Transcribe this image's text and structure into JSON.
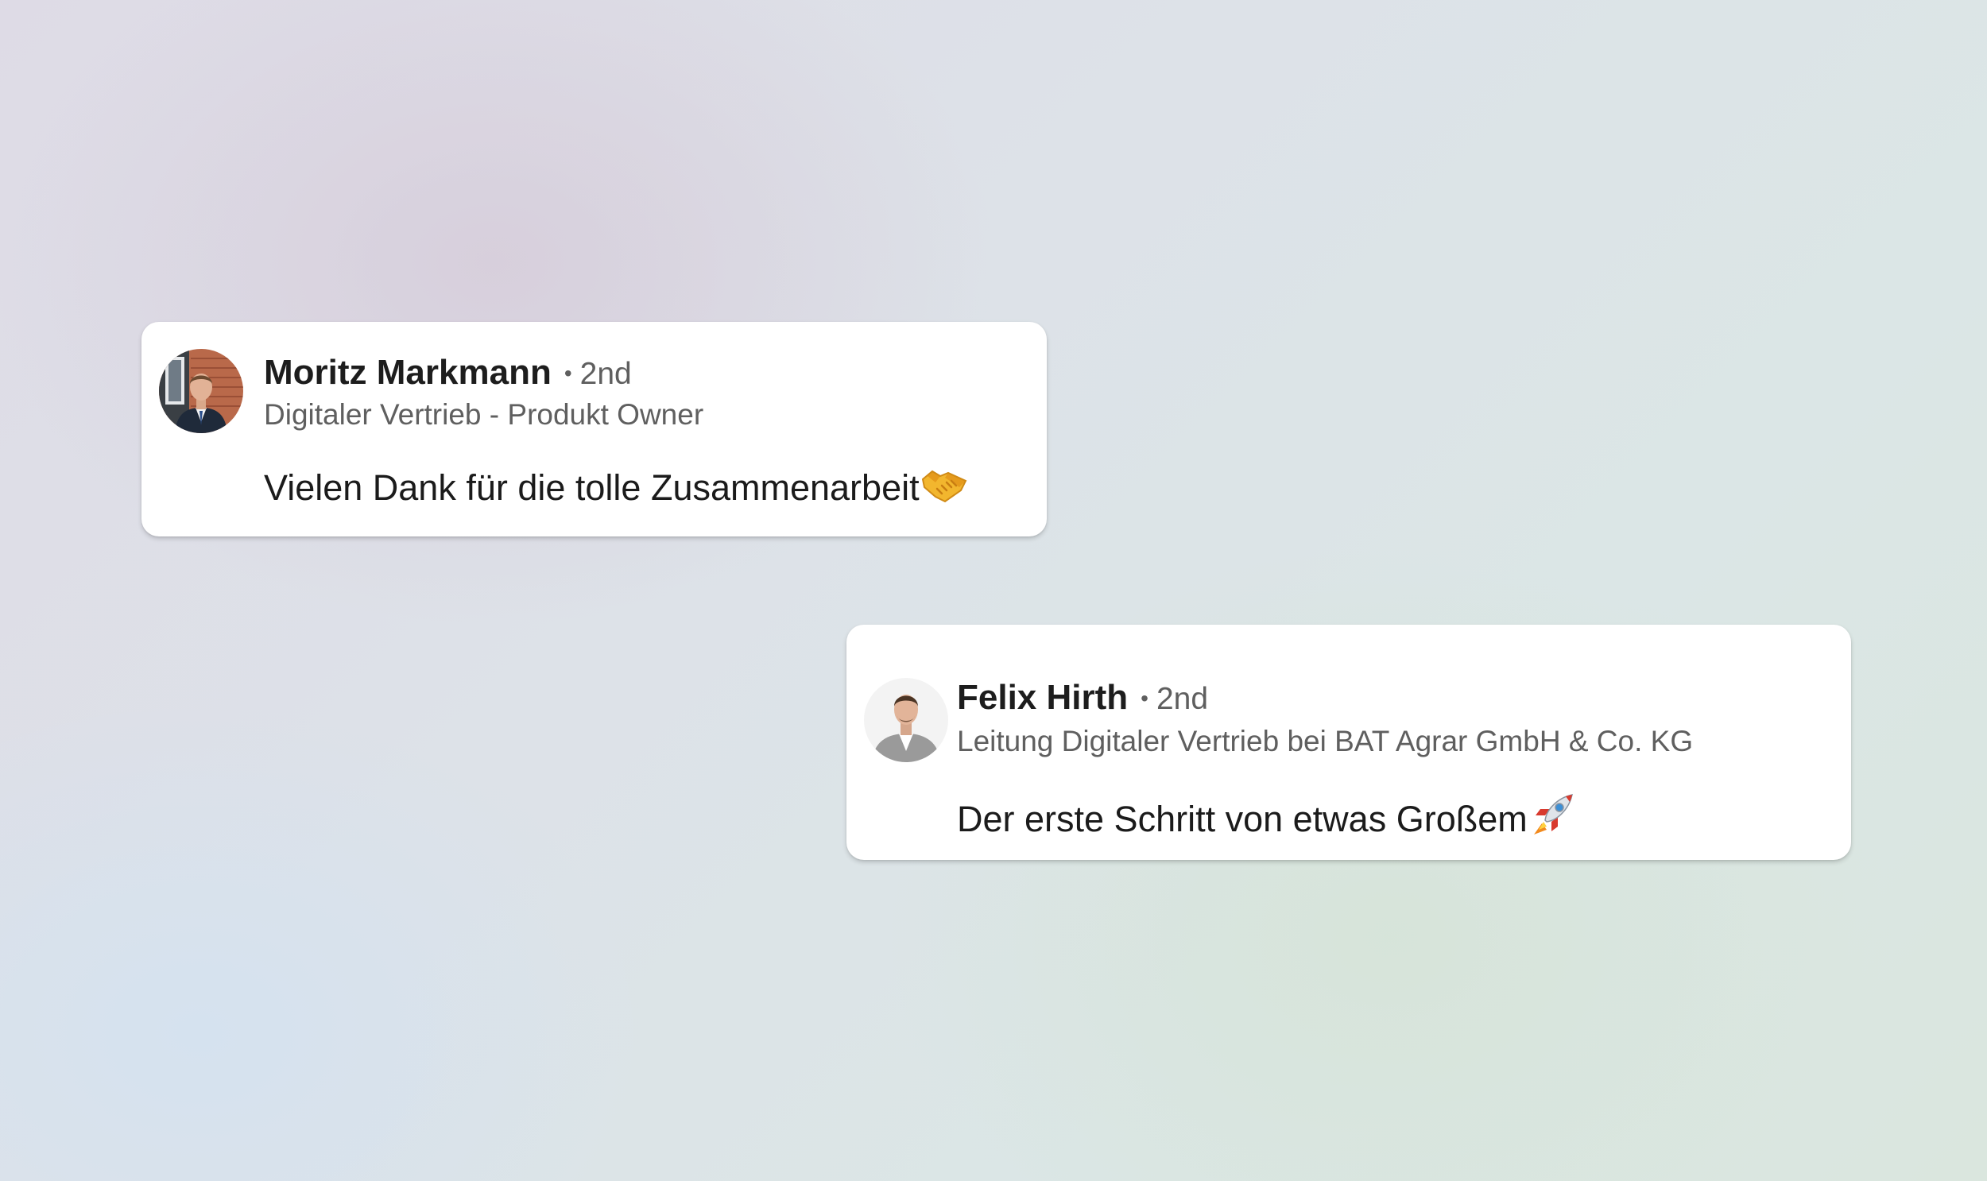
{
  "comments": [
    {
      "author": "Moritz Markmann",
      "separator": "•",
      "degree": "2nd",
      "headline": "Digitaler Vertrieb - Produkt Owner",
      "message": "Vielen Dank für die tolle Zusammenarbeit",
      "emoji": "handshake-emoji"
    },
    {
      "author": "Felix Hirth",
      "separator": "•",
      "degree": "2nd",
      "headline": "Leitung Digitaler Vertrieb bei BAT Agrar GmbH & Co. KG",
      "message": "Der erste Schritt von etwas Großem",
      "emoji": "rocket-emoji"
    }
  ]
}
